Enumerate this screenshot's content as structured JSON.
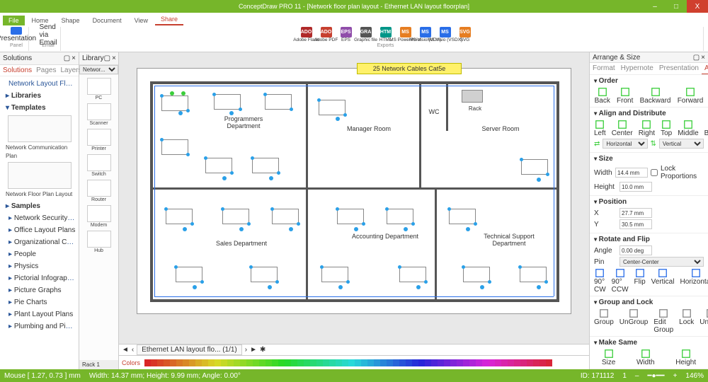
{
  "app": {
    "title": "ConceptDraw PRO 11 - [Network floor plan layout - Ethernet LAN layout floorplan]"
  },
  "wincontrols": {
    "min": "–",
    "max": "□",
    "close": "X"
  },
  "ribbon": {
    "tabs": [
      "File",
      "Home",
      "Shape",
      "Document",
      "View",
      "Share"
    ],
    "active": "Share",
    "groups": {
      "panel": {
        "label": "Panel",
        "items": [
          "Presentation"
        ]
      },
      "email": {
        "label": "Email",
        "items": [
          "Send via Email"
        ]
      },
      "exports": {
        "label": "Exports",
        "items": [
          "Adobe Flash",
          "Adobe PDF",
          "EPS",
          "Graphic file",
          "HTML",
          "MS PowerPoint",
          "MS Visio (VDX)",
          "MS Visio (VSDX)",
          "SVG"
        ]
      }
    },
    "colors": [
      "#b02a2a",
      "#c74030",
      "#904eaa",
      "#555",
      "#009688",
      "#e67e22",
      "#2a6ee8",
      "#2a6ee8",
      "#e67e22"
    ]
  },
  "solutions": {
    "title": "Solutions",
    "tabs": [
      "Solutions",
      "Pages",
      "Layers"
    ],
    "items": [
      "Network Layout Floor Plans",
      "Libraries",
      "Templates",
      "Network Communication Plan",
      "Network Floor Plan Layout",
      "Samples",
      "Network Security Diagrams",
      "Office Layout Plans",
      "Organizational Charts",
      "People",
      "Physics",
      "Pictorial Infographics",
      "Picture Graphs",
      "Pie Charts",
      "Plant Layout Plans",
      "Plumbing and Piping Plans"
    ]
  },
  "library": {
    "title": "Library",
    "category": "Networ...",
    "items": [
      "PC",
      "Scanner",
      "Printer",
      "Switch",
      "Router",
      "Modem",
      "Hub"
    ],
    "footer": "Rack 1"
  },
  "canvas": {
    "callout": "25 Network Cables Cat5e",
    "rooms": [
      "Programmers Department",
      "Manager Room",
      "WC",
      "Server Room",
      "Sales Department",
      "Accounting Department",
      "Technical Support Department"
    ],
    "rack": "Rack",
    "doctab": "Ethernet LAN layout flo... (1/1)"
  },
  "colorsbar": {
    "label": "Colors"
  },
  "right": {
    "title": "Arrange & Size",
    "tabs": [
      "Format",
      "Hypernote",
      "Presentation",
      "Arrange & Size"
    ],
    "order": {
      "h": "Order",
      "items": [
        "Back",
        "Front",
        "Backward",
        "Forward"
      ]
    },
    "align": {
      "h": "Align and Distribute",
      "items": [
        "Left",
        "Center",
        "Right",
        "Top",
        "Middle",
        "Bottom"
      ],
      "horiz": "Horizontal",
      "vert": "Vertical"
    },
    "size": {
      "h": "Size",
      "width": "14.4 mm",
      "height": "10.0 mm",
      "lock": "Lock Proportions"
    },
    "position": {
      "h": "Position",
      "x": "27.7 mm",
      "y": "30.5 mm"
    },
    "rotate": {
      "h": "Rotate and Flip",
      "angle": "0.00 deg",
      "center": "Center-Center",
      "items": [
        "90° CW",
        "90° CCW",
        "Flip",
        "Vertical",
        "Horizontal"
      ]
    },
    "group": {
      "h": "Group and Lock",
      "items": [
        "Group",
        "UnGroup",
        "Edit Group",
        "Lock",
        "Unlock"
      ]
    },
    "make": {
      "h": "Make Same",
      "items": [
        "Size",
        "Width",
        "Height"
      ]
    }
  },
  "status": {
    "mouse": "Mouse [ 1.27, 0.73 ] mm",
    "dims": "Width: 14.37 mm;   Height: 9.99 mm;   Angle: 0.00°",
    "id": "ID: 171112",
    "page": "1",
    "zoom": "146%"
  }
}
